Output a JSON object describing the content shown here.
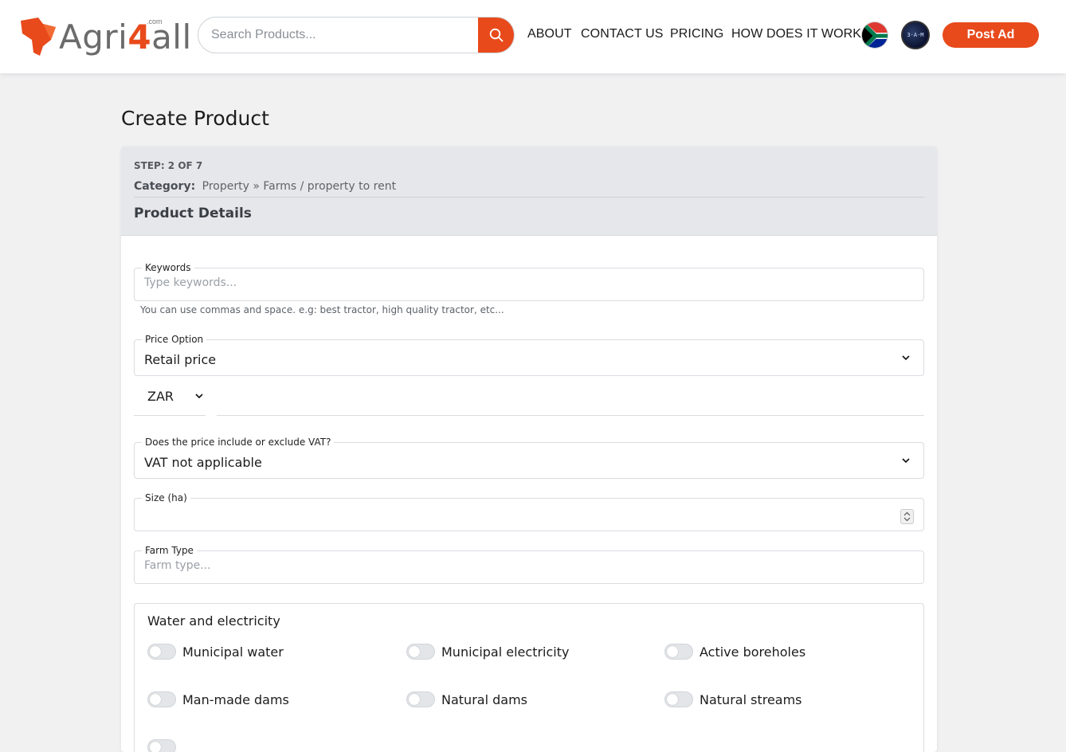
{
  "header": {
    "logo": {
      "text_prefix": "Agri",
      "text_number": "4",
      "text_suffix": "all",
      "domain": ".com",
      "brand_color": "#e84a1c"
    },
    "search": {
      "placeholder": "Search Products...",
      "icon": "search-icon"
    },
    "nav": [
      "ABOUT",
      "CONTACT US",
      "PRICING",
      "HOW DOES IT WORK"
    ],
    "flag_icon": "south-africa-flag-icon",
    "avatar_text": "3·A·M",
    "post_ad_label": "Post Ad"
  },
  "page": {
    "title": "Create Product"
  },
  "card": {
    "step": "STEP: 2 OF 7",
    "category_label": "Category:",
    "category_path": "Property »  Farms / property to rent",
    "section_title": "Product Details"
  },
  "form": {
    "keywords": {
      "label": "Keywords",
      "placeholder": "Type keywords...",
      "hint": "You can use commas and space. e.g: best tractor, high quality tractor, etc..."
    },
    "price_option": {
      "label": "Price Option",
      "value": "Retail price"
    },
    "currency": {
      "value": "ZAR"
    },
    "vat": {
      "label": "Does the price include or exclude VAT?",
      "value": "VAT not applicable"
    },
    "size": {
      "label": "Size (ha)",
      "value": ""
    },
    "farm_type": {
      "label": "Farm Type",
      "placeholder": "Farm type..."
    },
    "water_electricity": {
      "title": "Water and electricity",
      "options": [
        "Municipal water",
        "Municipal electricity",
        "Active boreholes",
        "Man-made dams",
        "Natural dams",
        "Natural streams"
      ]
    }
  }
}
